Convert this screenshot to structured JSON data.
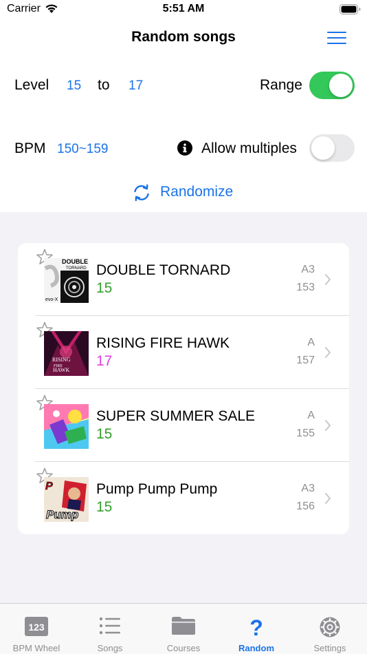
{
  "status_bar": {
    "carrier": "Carrier",
    "time": "5:51 AM"
  },
  "header": {
    "title": "Random songs",
    "menu_icon": "hamburger-icon"
  },
  "filters": {
    "level_label": "Level",
    "level_from": "15",
    "to_label": "to",
    "level_to": "17",
    "range_label": "Range",
    "range_on": true,
    "bpm_label": "BPM",
    "bpm_value": "150~159",
    "allow_multiples_label": "Allow multiples",
    "allow_multiples_on": false,
    "randomize_label": "Randomize"
  },
  "songs": [
    {
      "title": "DOUBLE TORNARD",
      "level": "15",
      "level_color": "#34a02c",
      "chart_type": "A3",
      "bpm": "153",
      "jacket_text": "DOUBLE TORNARD"
    },
    {
      "title": "RISING FIRE HAWK",
      "level": "17",
      "level_color": "#e040e0",
      "chart_type": "A",
      "bpm": "157",
      "jacket_text": "RISING FIRE HAWK"
    },
    {
      "title": "SUPER SUMMER SALE",
      "level": "15",
      "level_color": "#34a02c",
      "chart_type": "A",
      "bpm": "155",
      "jacket_text": ""
    },
    {
      "title": "Pump Pump Pump",
      "level": "15",
      "level_color": "#34a02c",
      "chart_type": "A3",
      "bpm": "156",
      "jacket_text": "Pump"
    }
  ],
  "tabs": [
    {
      "label": "BPM Wheel",
      "icon": "bpm-wheel-icon",
      "active": false
    },
    {
      "label": "Songs",
      "icon": "list-icon",
      "active": false
    },
    {
      "label": "Courses",
      "icon": "folder-icon",
      "active": false
    },
    {
      "label": "Random",
      "icon": "question-icon",
      "active": true
    },
    {
      "label": "Settings",
      "icon": "gear-icon",
      "active": false
    }
  ],
  "colors": {
    "accent": "#1a73e8",
    "toggle_on": "#34c759",
    "level_green": "#34a02c",
    "level_magenta": "#e040e0"
  }
}
